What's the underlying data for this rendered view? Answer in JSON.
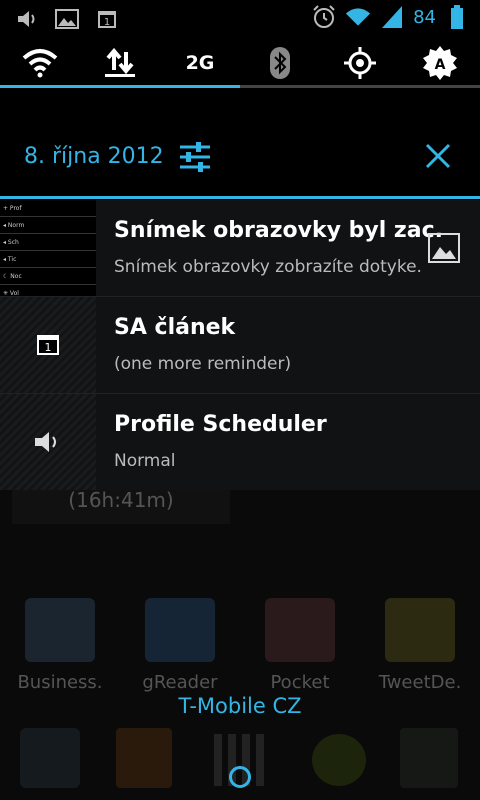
{
  "statusbar": {
    "battery": "84",
    "accent": "#33b5e5"
  },
  "toggles": [
    {
      "icon": "wifi-icon",
      "label": "",
      "on": true
    },
    {
      "icon": "data-transfer-icon",
      "label": "",
      "on": true
    },
    {
      "icon": "network-mode",
      "label": "2G",
      "on": true
    },
    {
      "icon": "bluetooth-icon",
      "label": "",
      "on": false
    },
    {
      "icon": "gps-icon",
      "label": "",
      "on": false
    },
    {
      "icon": "auto-brightness-icon",
      "label": "",
      "on": false
    }
  ],
  "header": {
    "date": "8. října 2012"
  },
  "notifications": [
    {
      "title": "Snímek obrazovky byl zac.",
      "text": "Snímek obrazovky zobrazíte dotyke."
    },
    {
      "title": "SA článek",
      "text": "(one more reminder)"
    },
    {
      "title": "Profile Scheduler",
      "text": "Normal"
    }
  ],
  "background": {
    "timer": "(16h:41m)",
    "apps": [
      "Business.",
      "gReader",
      "Pocket",
      "TweetDe."
    ],
    "carrier": "T-Mobile CZ"
  }
}
